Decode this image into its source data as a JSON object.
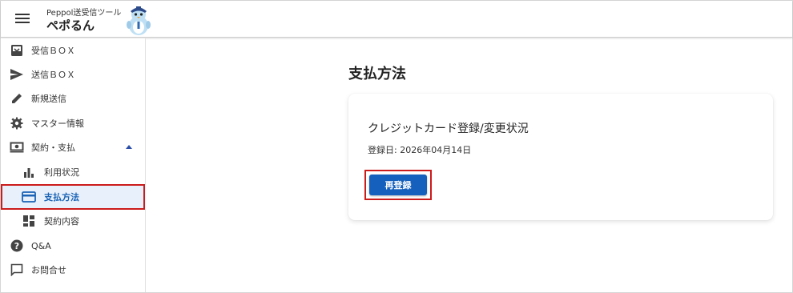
{
  "header": {
    "app_subtitle": "Peppol送受信ツール",
    "app_name": "ペポるん"
  },
  "sidebar": {
    "items": [
      {
        "label": "受信ＢＯＸ",
        "icon": "inbox-icon"
      },
      {
        "label": "送信ＢＯＸ",
        "icon": "send-icon"
      },
      {
        "label": "新規送信",
        "icon": "pencil-icon"
      },
      {
        "label": "マスター情報",
        "icon": "gear-icon"
      },
      {
        "label": "契約・支払",
        "icon": "money-icon"
      },
      {
        "label": "利用状況",
        "icon": "bar-chart-icon"
      },
      {
        "label": "支払方法",
        "icon": "credit-card-icon"
      },
      {
        "label": "契約内容",
        "icon": "dashboard-icon"
      },
      {
        "label": "Q&A",
        "icon": "help-icon"
      },
      {
        "label": "お問合せ",
        "icon": "chat-icon"
      }
    ],
    "active": "支払方法"
  },
  "main": {
    "page_title": "支払方法",
    "card": {
      "title": "クレジットカード登録/変更状況",
      "date_text": "登録日: 2026年04月14日",
      "button_label": "再登録"
    }
  },
  "colors": {
    "accent": "#1560bd",
    "highlight": "#cc1b1b",
    "active_bg": "#e8f1fb"
  }
}
